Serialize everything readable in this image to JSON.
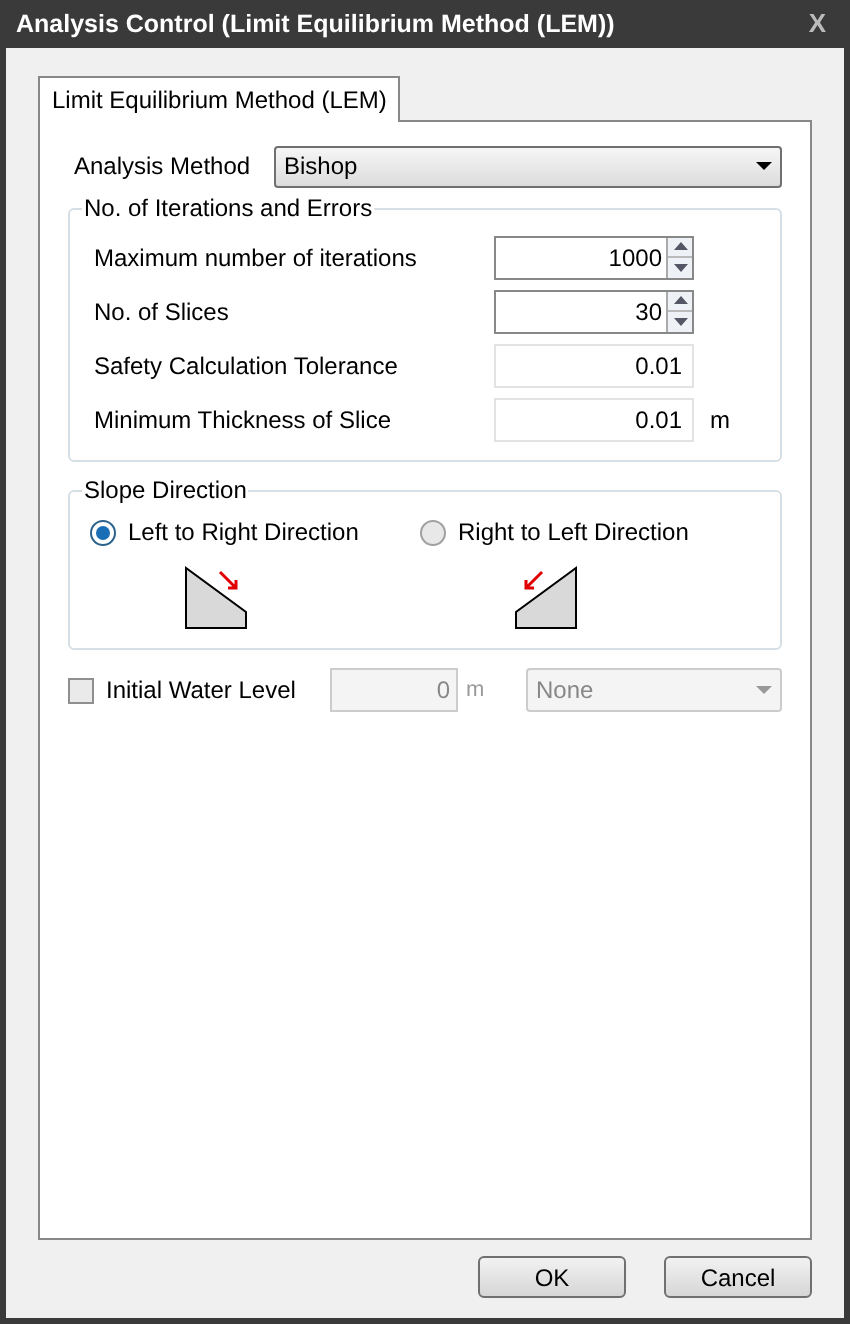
{
  "window": {
    "title": "Analysis Control (Limit Equilibrium Method (LEM))",
    "close": "X"
  },
  "tabs": [
    {
      "label": "Limit Equilibrium Method (LEM)",
      "selected": true
    }
  ],
  "analysis_method": {
    "label": "Analysis Method",
    "value": "Bishop"
  },
  "iterations_group": {
    "title": "No. of Iterations and Errors",
    "rows": [
      {
        "kind": "spin",
        "label": "Maximum number of iterations",
        "value": "1000"
      },
      {
        "kind": "spin",
        "label": "No. of Slices",
        "value": "30"
      },
      {
        "kind": "text",
        "label": "Safety Calculation Tolerance",
        "value": "0.01"
      },
      {
        "kind": "text",
        "label": "Minimum Thickness of Slice",
        "value": "0.01",
        "unit": "m"
      }
    ]
  },
  "slope_direction": {
    "title": "Slope Direction",
    "options": [
      {
        "label": "Left to Right Direction",
        "selected": true
      },
      {
        "label": "Right to Left Direction",
        "selected": false
      }
    ]
  },
  "initial_water_level": {
    "label": "Initial Water Level",
    "checked": false,
    "value": "0",
    "unit": "m",
    "select": "None",
    "disabled": true
  },
  "buttons": [
    "OK",
    "Cancel"
  ]
}
